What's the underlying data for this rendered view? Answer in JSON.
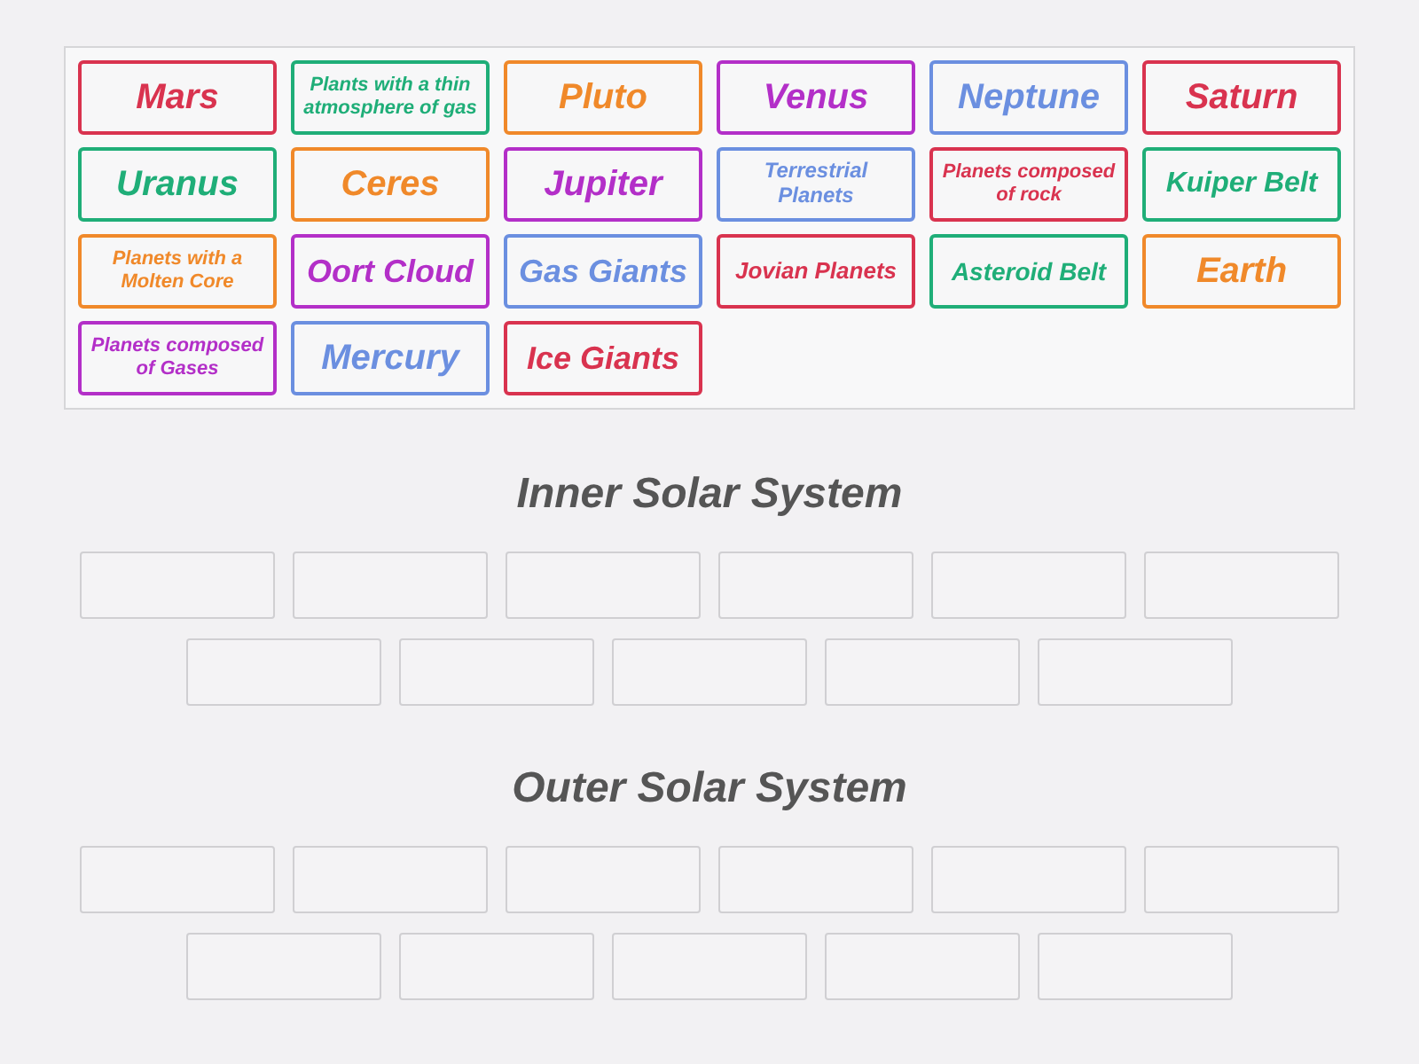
{
  "card_pool": {
    "cards": [
      {
        "label": "Mars",
        "color": "#d9334f"
      },
      {
        "label": "Plants with a thin atmosphere of gas",
        "color": "#1fae78"
      },
      {
        "label": "Pluto",
        "color": "#f0892a"
      },
      {
        "label": "Venus",
        "color": "#b32fc8"
      },
      {
        "label": "Neptune",
        "color": "#6b8fe0"
      },
      {
        "label": "Saturn",
        "color": "#d9334f"
      },
      {
        "label": "Uranus",
        "color": "#1fae78"
      },
      {
        "label": "Ceres",
        "color": "#f0892a"
      },
      {
        "label": "Jupiter",
        "color": "#b32fc8"
      },
      {
        "label": "Terrestrial Planets",
        "color": "#6b8fe0"
      },
      {
        "label": "Planets composed of rock",
        "color": "#d9334f"
      },
      {
        "label": "Kuiper Belt",
        "color": "#1fae78"
      },
      {
        "label": "Planets with a Molten Core",
        "color": "#f0892a"
      },
      {
        "label": "Oort Cloud",
        "color": "#b32fc8"
      },
      {
        "label": "Gas Giants",
        "color": "#6b8fe0"
      },
      {
        "label": "Jovian Planets",
        "color": "#d9334f"
      },
      {
        "label": "Asteroid Belt",
        "color": "#1fae78"
      },
      {
        "label": "Earth",
        "color": "#f0892a"
      },
      {
        "label": "Planets composed of Gases",
        "color": "#b32fc8"
      },
      {
        "label": "Mercury",
        "color": "#6b8fe0"
      },
      {
        "label": "Ice Giants",
        "color": "#d9334f"
      }
    ]
  },
  "groups": [
    {
      "title": "Inner Solar System"
    },
    {
      "title": "Outer Solar System"
    }
  ]
}
